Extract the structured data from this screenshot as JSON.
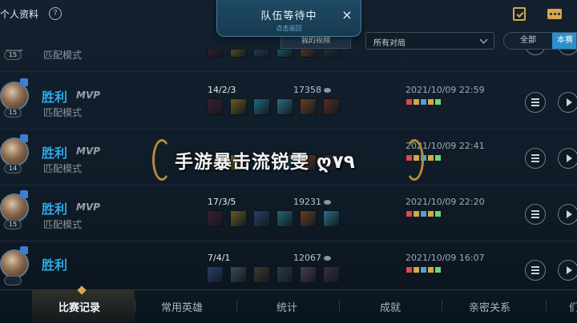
{
  "header": {
    "title": "个人资料",
    "help_glyph": "?",
    "icons": [
      "clipboard-check-icon",
      "chat-icon"
    ]
  },
  "queue_popup": {
    "title": "队伍等待中",
    "subtitle": "点击返回",
    "close_glyph": "×"
  },
  "filters": {
    "button_label": "我的视频",
    "match_select": "所有对局",
    "segments": [
      "全部",
      "本赛"
    ]
  },
  "watermark": {
    "text": "手游暴击流锐雯 ღ٧٩"
  },
  "colors": {
    "accent_blue": "#2ea9e6",
    "gold": "#d7a74a",
    "segment_active": "#2b8fc9"
  },
  "matches": [
    {
      "result": "",
      "mvp": "",
      "mode": "匹配模式",
      "level": "15",
      "kda": "",
      "gold": "",
      "time": "",
      "items": [
        "#3a1e2a",
        "#6b5a1e",
        "#2b3f6a",
        "#1f6a78",
        "#6a3e22",
        "#2c2d3a"
      ]
    },
    {
      "result": "胜利",
      "mvp": "MVP",
      "mode": "匹配模式",
      "level": "15",
      "kda": "14/2/3",
      "gold": "17358",
      "time": "2021/10/09 22:59",
      "items": [
        "#3a1e2a",
        "#6b5a1e",
        "#1f6a78",
        "#2a6f80",
        "#6a3e22",
        "#5a2a1e"
      ]
    },
    {
      "result": "胜利",
      "mvp": "MVP",
      "mode": "匹配模式",
      "level": "14",
      "kda": "",
      "gold": "",
      "time": "2021/10/09 22:41",
      "items": [
        "#3a1e2a",
        "#6b5a1e",
        "#1f6a78",
        "#2a6f80",
        "#6a3e22",
        "#2c2d3a"
      ]
    },
    {
      "result": "胜利",
      "mvp": "MVP",
      "mode": "匹配模式",
      "level": "15",
      "kda": "17/3/5",
      "gold": "19231",
      "time": "2021/10/09 22:20",
      "items": [
        "#3a1e2a",
        "#6b5a1e",
        "#2b3f6a",
        "#1f6a78",
        "#6a3e22",
        "#2a6f80"
      ]
    },
    {
      "result": "胜利",
      "mvp": "",
      "mode": "",
      "level": "",
      "kda": "7/4/1",
      "gold": "12067",
      "time": "2021/10/09 16:07",
      "items": [
        "#2b3f6a",
        "#3a4a5a",
        "#3d3a2a",
        "#2c3a4a",
        "#4a3a5a",
        "#3a2a4a"
      ]
    }
  ],
  "bottom_nav": [
    "比赛记录",
    "常用英雄",
    "统计",
    "成就",
    "亲密关系",
    "们"
  ]
}
